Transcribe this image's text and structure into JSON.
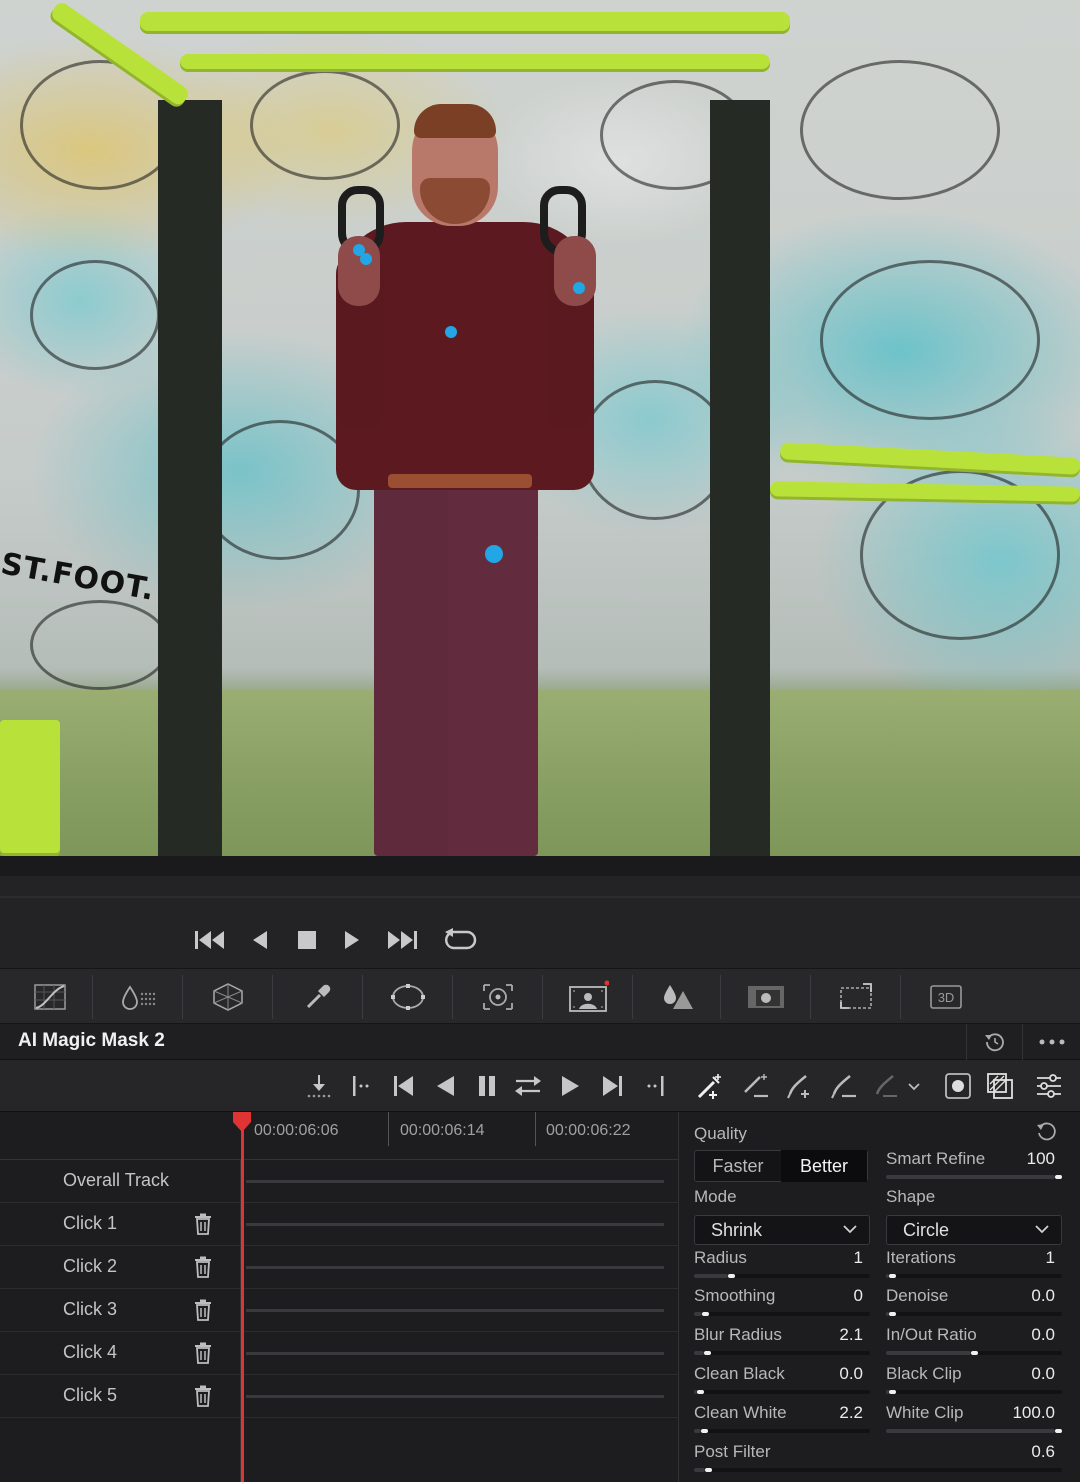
{
  "panel": {
    "title": "AI Magic Mask 2"
  },
  "viewer": {
    "graffiti_text": "ST.FOOT."
  },
  "timeline": {
    "ticks": [
      "00:00:06:06",
      "00:00:06:14",
      "00:00:06:22"
    ],
    "tracks": [
      "Overall Track",
      "Click 1",
      "Click 2",
      "Click 3",
      "Click 4",
      "Click 5"
    ]
  },
  "settings": {
    "quality_label": "Quality",
    "quality_options": [
      "Faster",
      "Better"
    ],
    "quality_selected": "Better",
    "smart_refine": {
      "label": "Smart Refine",
      "value": "100",
      "level": 1.0
    },
    "mode": {
      "label": "Mode",
      "value": "Shrink"
    },
    "shape": {
      "label": "Shape",
      "value": "Circle"
    },
    "radius": {
      "label": "Radius",
      "value": "1",
      "level": 0.2
    },
    "iterations": {
      "label": "Iterations",
      "value": "1",
      "level": 0.02
    },
    "smoothing": {
      "label": "Smoothing",
      "value": "0",
      "level": 0.05
    },
    "denoise": {
      "label": "Denoise",
      "value": "0.0",
      "level": 0.02
    },
    "blur_radius": {
      "label": "Blur Radius",
      "value": "2.1",
      "level": 0.06
    },
    "in_out_ratio": {
      "label": "In/Out Ratio",
      "value": "0.0",
      "level": 0.5
    },
    "clean_black": {
      "label": "Clean Black",
      "value": "0.0",
      "level": 0.02
    },
    "black_clip": {
      "label": "Black Clip",
      "value": "0.0",
      "level": 0.02
    },
    "clean_white": {
      "label": "Clean White",
      "value": "2.2",
      "level": 0.04
    },
    "white_clip": {
      "label": "White Clip",
      "value": "100.0",
      "level": 1.0
    },
    "post_filter": {
      "label": "Post Filter",
      "value": "0.6",
      "level": 0.03
    }
  },
  "colors": {
    "mask_dot": "#22a6e6",
    "playhead": "#e03434",
    "accent_green": "#b8e23a"
  }
}
